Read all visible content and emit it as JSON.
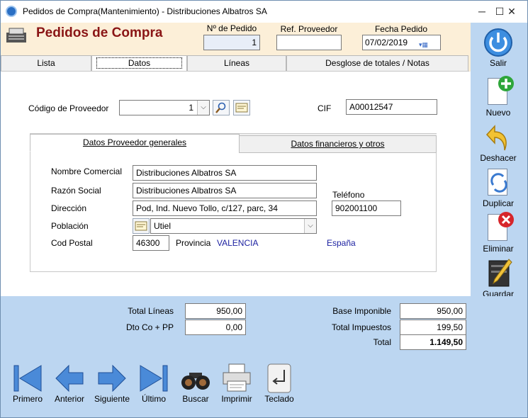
{
  "window": {
    "title": "Pedidos de Compra(Mantenimiento) - Distribuciones Albatros SA",
    "minimize": "─",
    "maximize": "☐",
    "close": "✕"
  },
  "header": {
    "title": "Pedidos de Compra",
    "pedido_label": "Nº de Pedido",
    "pedido_value": "1",
    "ref_label": "Ref. Proveedor",
    "ref_value": "",
    "fecha_label": "Fecha Pedido",
    "fecha_value": "07/02/2019"
  },
  "tabs": [
    {
      "label": "Lista"
    },
    {
      "label": "Datos"
    },
    {
      "label": "Líneas"
    },
    {
      "label": "Desglose de totales / Notas"
    }
  ],
  "proveedor": {
    "codigo_label": "Código de Proveedor",
    "codigo_value": "1",
    "cif_label": "CIF",
    "cif_value": "A00012547"
  },
  "subtabs": [
    {
      "label": "Datos Proveedor generales"
    },
    {
      "label": "Datos financieros y otros"
    }
  ],
  "datos": {
    "nombre_label": "Nombre Comercial",
    "nombre_value": "Distribuciones Albatros SA",
    "razon_label": "Razón Social",
    "razon_value": "Distribuciones Albatros SA",
    "telefono_label": "Teléfono",
    "telefono_value": "902001100",
    "direccion_label": "Dirección",
    "direccion_value": "Pod, Ind. Nuevo Tollo, c/127, parc, 34",
    "poblacion_label": "Población",
    "poblacion_value": "Utiel",
    "cp_label": "Cod Postal",
    "cp_value": "46300",
    "provincia_label": "Provincia",
    "provincia_value": "VALENCIA",
    "pais_value": "España"
  },
  "actions": {
    "salir": "Salir",
    "nuevo": "Nuevo",
    "deshacer": "Deshacer",
    "duplicar": "Duplicar",
    "eliminar": "Eliminar",
    "guardar": "Guardar"
  },
  "totals": {
    "total_lineas_label": "Total Líneas",
    "total_lineas_value": "950,00",
    "dto_label": "Dto Co + PP",
    "dto_value": "0,00",
    "base_label": "Base Imponible",
    "base_value": "950,00",
    "impuestos_label": "Total Impuestos",
    "impuestos_value": "199,50",
    "total_label": "Total",
    "total_value": "1.149,50"
  },
  "nav": {
    "primero": "Primero",
    "anterior": "Anterior",
    "siguiente": "Siguiente",
    "ultimo": "Último",
    "buscar": "Buscar",
    "imprimir": "Imprimir",
    "teclado": "Teclado"
  },
  "colors": {
    "title": "#8a1515",
    "header_bg": "#fcefd8",
    "panel_bg": "#bcd6f1",
    "link": "#1a1fa0"
  }
}
